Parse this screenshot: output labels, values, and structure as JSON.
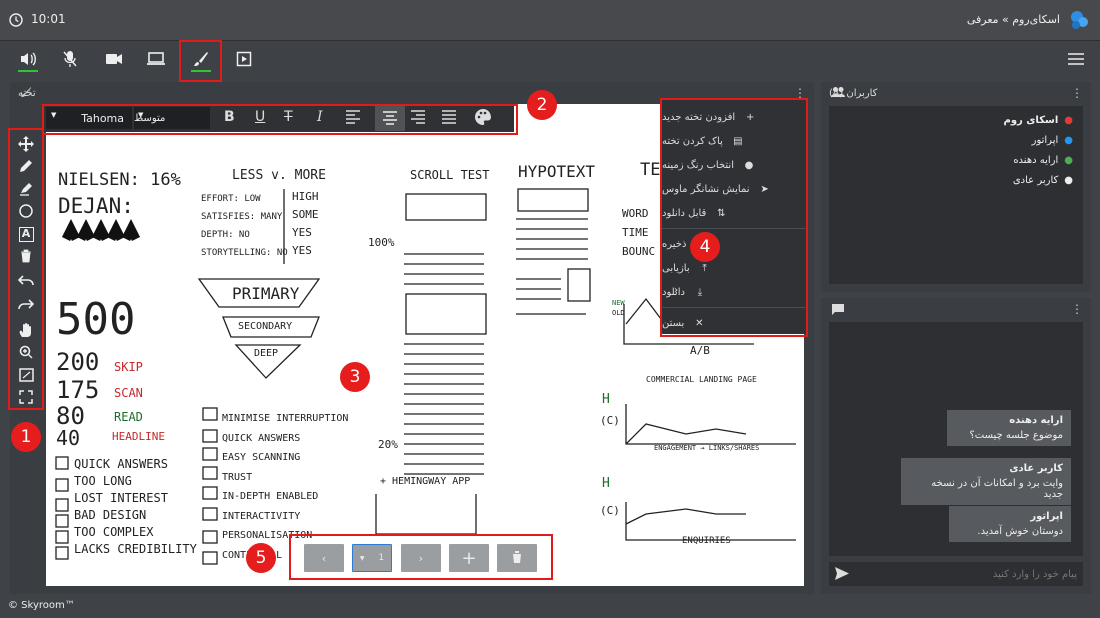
{
  "header": {
    "time": "10:01",
    "breadcrumb": "اسکای‌روم » معرفی",
    "clock_icon": "clock-icon",
    "logo_icon": "skyroom-logo-icon"
  },
  "toolbar": {
    "buttons": [
      "speaker-icon",
      "mic-off-icon",
      "camera-icon",
      "screen-share-icon",
      "whiteboard-brush-icon",
      "presentation-icon"
    ],
    "menu_icon": "hamburger-menu-icon",
    "active_underline": "#31c431"
  },
  "board": {
    "title": "تخته",
    "font_name": "Tahoma",
    "font_size": "متوسط"
  },
  "board_menu": {
    "items": [
      "افزودن تخته جدید",
      "پاک کردن تخته",
      "انتخاب رنگ زمینه",
      "نمایش نشانگر ماوس",
      "قابل دانلود",
      "ذخیره",
      "بازیابی",
      "دانلود",
      "بستن"
    ]
  },
  "users": {
    "title": "کاربران (4)",
    "list": [
      {
        "name": "اسکای روم",
        "color": "#e53935"
      },
      {
        "name": "اپراتور",
        "color": "#2196f3"
      },
      {
        "name": "ارایه دهنده",
        "color": "#4caf50"
      },
      {
        "name": "کاربر عادی",
        "color": "#eeeeee"
      }
    ]
  },
  "chat": {
    "messages": [
      {
        "sender": "ارایه دهنده",
        "text": "موضوع جلسه چیست؟"
      },
      {
        "sender": "کاربر عادی",
        "text": "وایت برد و امکانات آن در نسخه جدید"
      },
      {
        "sender": "اپراتور",
        "text": "دوستان خوش آمدید."
      }
    ],
    "placeholder": "پیام خود را وارد کنید"
  },
  "pager": {
    "page": "1"
  },
  "footer": {
    "copyright": "© Skyroom™"
  },
  "badges": [
    "1",
    "2",
    "3",
    "4",
    "5"
  ],
  "sketch": {
    "nielsen": "NIELSEN: 16%",
    "dejan": "DEJAN:",
    "n500": "500",
    "n200": "200",
    "n175": "175",
    "n80": "80",
    "n40": "40",
    "skip": "SKIP",
    "scan": "SCAN",
    "read": "READ",
    "headline": "HEADLINE",
    "left_list": [
      "QUICK ANSWERS",
      "TOO LONG",
      "LOST INTEREST",
      "BAD DESIGN",
      "TOO COMPLEX",
      "LACKS CREDIBILITY"
    ],
    "less_more": "LESS v. MORE",
    "effort": "EFFORT: LOW",
    "satisfies": "SATISFIES: MANY",
    "depth": "DEPTH: NO",
    "storytelling": "STORYTELLING: NO",
    "high": "HIGH",
    "some": "SOME",
    "yes1": "YES",
    "yes2": "YES",
    "primary": "PRIMARY",
    "secondary": "SECONDARY",
    "deep": "DEEP",
    "mid_list": [
      "MINIMISE INTERRUPTION",
      "QUICK ANSWERS",
      "EASY SCANNING",
      "TRUST",
      "IN-DEPTH ENABLED",
      "INTERACTIVITY",
      "PERSONALISATION",
      "CONTEXTUAL"
    ],
    "scroll": "SCROLL TEST",
    "hypo": "HYPOTEXT",
    "p100": "100%",
    "p20": "20%",
    "heming": "+ HEMINGWAY APP",
    "te": "TE",
    "word": "WORD",
    "time": "TIME",
    "bounce": "BOUNC",
    "ab": "A/B",
    "commercial": "COMMERCIAL LANDING PAGE",
    "engagement": "ENGAGEMENT → LINKS/SHARES",
    "enquiries": "ENQUIRIES",
    "h1": "H",
    "c1": "(C)",
    "h2": "H",
    "c2": "(C)",
    "new": "NEW",
    "old": "OLD"
  }
}
